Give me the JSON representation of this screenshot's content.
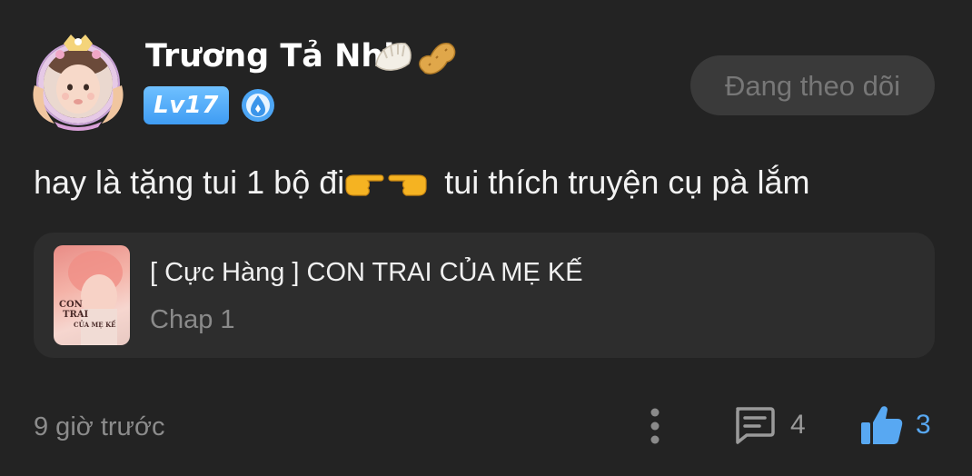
{
  "user": {
    "name": "Trương Tả Nhi",
    "emoji_1": "dumpling-icon",
    "emoji_2": "peanut-icon",
    "level": "Lv17",
    "rank_icon": "water-drop-badge-icon",
    "avatar": "avatar-child-photo"
  },
  "follow_button": {
    "label": "Đang theo dõi"
  },
  "comment": {
    "text_before": "hay là tặng tui 1 bộ đi",
    "emoji": [
      "point-right-icon",
      "point-left-icon"
    ],
    "text_after": "tui thích truyện cụ pà lắm"
  },
  "story": {
    "title": "[ Cực Hàng ] CON TRAI CỦA MẸ KẾ",
    "chapter": "Chap 1",
    "cover_text": [
      "CON",
      "TRAI",
      "CỦA MẸ KẾ"
    ]
  },
  "footer": {
    "timestamp": "9 giờ trước",
    "comment_count": "4",
    "like_count": "3"
  },
  "colors": {
    "background": "#232323",
    "card": "#2d2d2d",
    "accent": "#58a8f2",
    "level_badge": "#4aa4f5",
    "follow_button_bg": "#3a3a3a"
  }
}
